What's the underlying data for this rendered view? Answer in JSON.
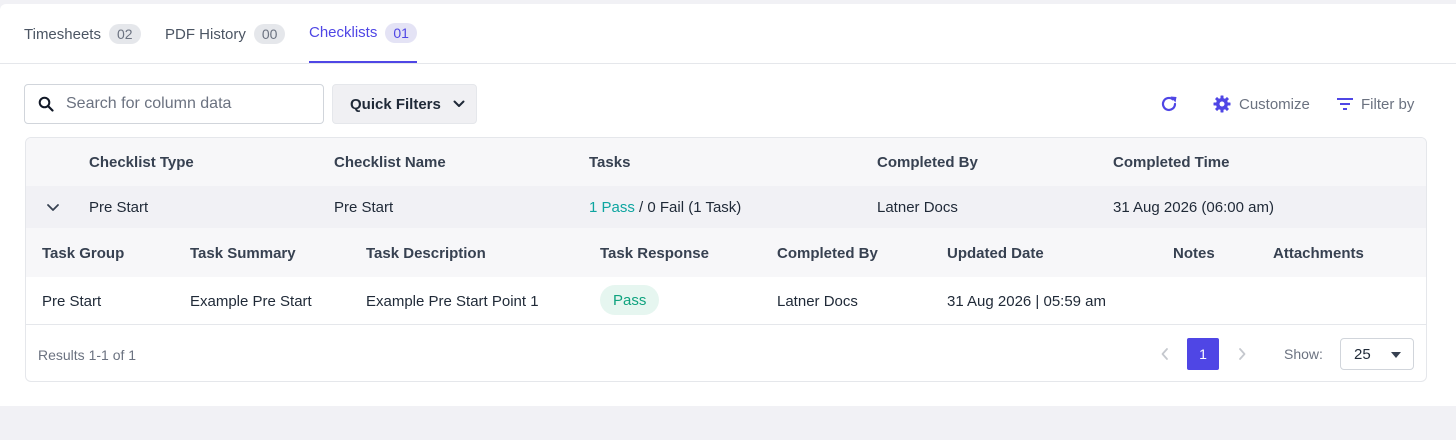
{
  "tabs": [
    {
      "label": "Timesheets",
      "count": "02"
    },
    {
      "label": "PDF History",
      "count": "00"
    },
    {
      "label": "Checklists",
      "count": "01"
    }
  ],
  "search": {
    "placeholder": "Search for column data"
  },
  "quick_filters": {
    "label": "Quick Filters"
  },
  "toolbar": {
    "customize_label": "Customize",
    "filter_label": "Filter by"
  },
  "table": {
    "headers": [
      "Checklist Type",
      "Checklist Name",
      "Tasks",
      "Completed By",
      "Completed Time"
    ],
    "row": {
      "checklist_type": "Pre Start",
      "checklist_name": "Pre Start",
      "tasks_pass": "1 Pass",
      "tasks_rest": " / 0 Fail (1 Task)",
      "completed_by": "Latner Docs",
      "completed_time": "31 Aug 2026 (06:00 am)"
    },
    "sub_headers": [
      "Task Group",
      "Task Summary",
      "Task Description",
      "Task Response",
      "Completed By",
      "Updated Date",
      "Notes",
      "Attachments"
    ],
    "sub_row": {
      "task_group": "Pre Start",
      "task_summary": "Example Pre Start",
      "task_description": "Example Pre Start Point 1",
      "task_response": "Pass",
      "completed_by": "Latner Docs",
      "updated_date": "31 Aug 2026 | 05:59 am",
      "notes": "",
      "attachments": ""
    }
  },
  "footer": {
    "results": "Results 1-1 of 1",
    "current_page": "1",
    "show_label": "Show:",
    "page_size": "25"
  },
  "colors": {
    "accent": "#4f46e5",
    "pass": "#10a37f",
    "pass_bg": "#e6f6f0"
  }
}
